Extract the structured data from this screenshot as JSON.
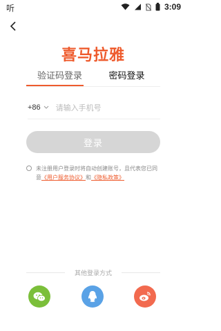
{
  "status_bar": {
    "left_text": "听",
    "time": "3:09",
    "icons": [
      "wifi-icon",
      "signal-icon",
      "sim-off-icon",
      "battery-icon"
    ]
  },
  "header": {
    "back_icon": "chevron-left-icon",
    "logo_text": "喜马拉雅"
  },
  "tabs": [
    {
      "label": "验证码登录",
      "active": true
    },
    {
      "label": "密码登录",
      "active": false
    }
  ],
  "phone": {
    "country_code": "+86",
    "placeholder": "请输入手机号",
    "value": ""
  },
  "login_button": {
    "label": "登录"
  },
  "agreement": {
    "text_prefix": "未注册用户登录时将自动创建账号，且代表您已同意",
    "link_user_agreement": "《用户服务协议》",
    "and_text": "和",
    "link_privacy": "《隐私政策》"
  },
  "other_login": {
    "title": "其他登录方式",
    "options": [
      "wechat-icon",
      "qq-icon",
      "weibo-icon"
    ]
  },
  "colors": {
    "accent": "#ee5b2d",
    "button_disabled": "#d6d6d6",
    "wechat": "#7bbf3a",
    "qq": "#5aa2e6",
    "weibo": "#f26a4f"
  }
}
